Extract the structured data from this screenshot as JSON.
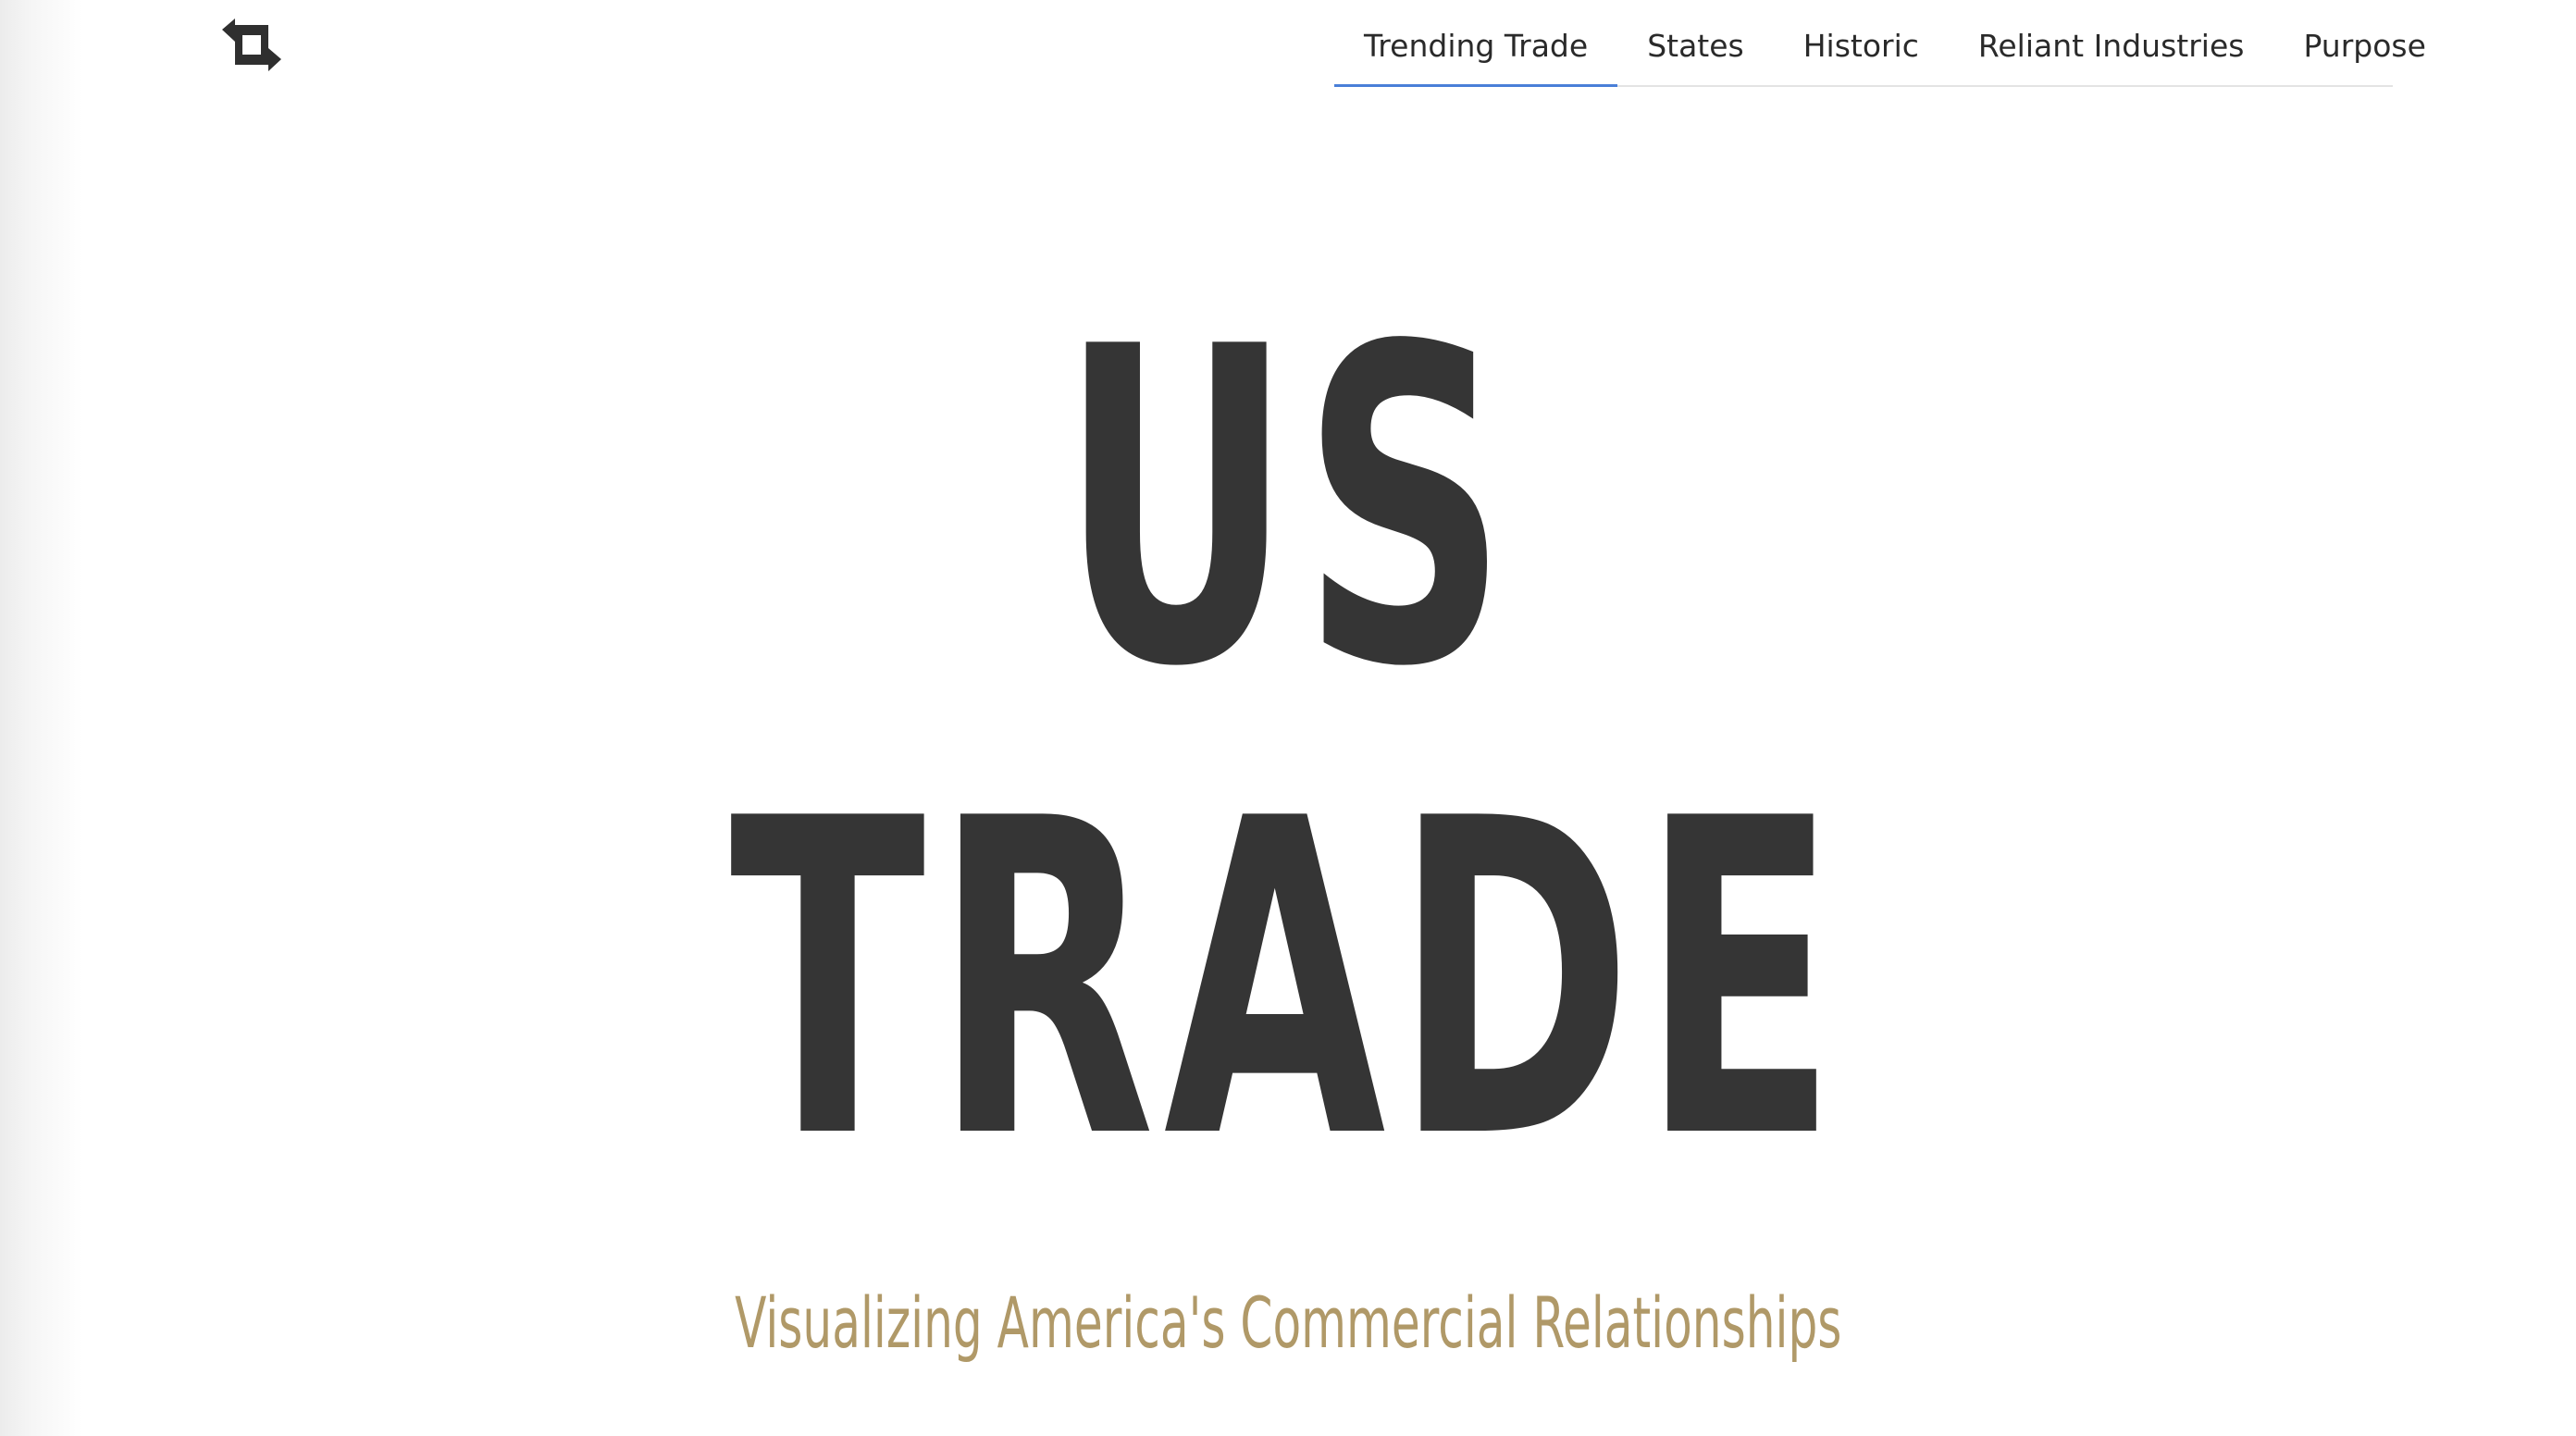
{
  "logo": {
    "icon": "swap-arrows-icon"
  },
  "nav": {
    "items": [
      {
        "label": "Trending Trade",
        "active": true
      },
      {
        "label": "States",
        "active": false
      },
      {
        "label": "Historic",
        "active": false
      },
      {
        "label": "Reliant Industries",
        "active": false
      },
      {
        "label": "Purpose",
        "active": false
      }
    ]
  },
  "hero": {
    "line1": "US",
    "line2": "TRADE",
    "subtitle": "Visualizing America's Commercial Relationships"
  },
  "colors": {
    "title": "#353535",
    "subtitle": "#b09968",
    "active_underline": "#4a7fd8"
  }
}
